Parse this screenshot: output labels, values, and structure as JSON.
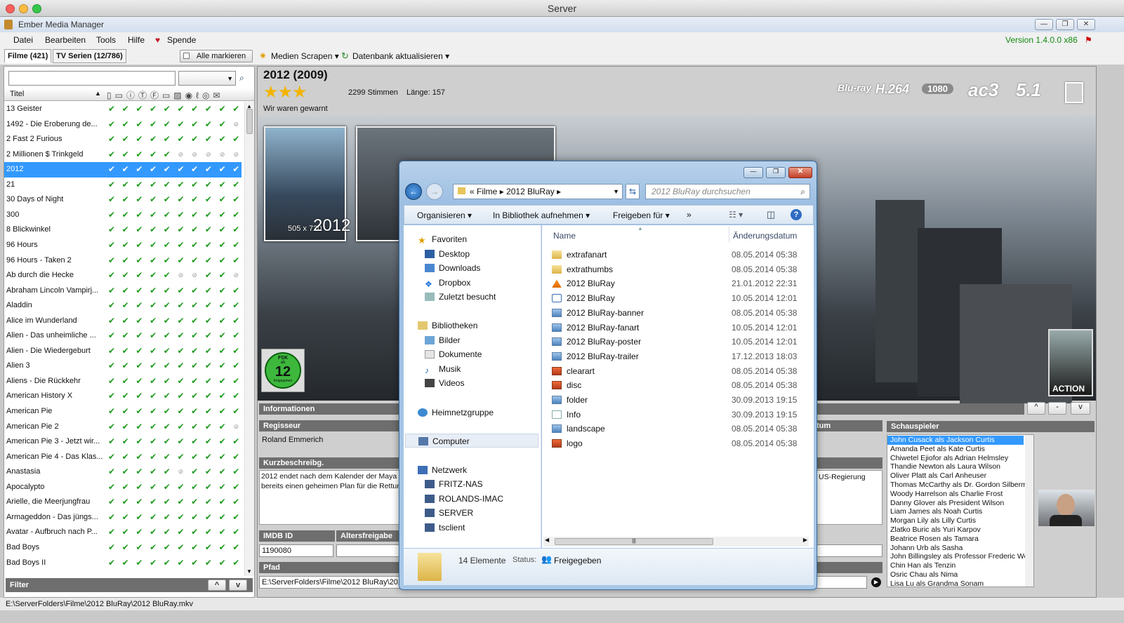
{
  "mac_title": "Server",
  "app_title": "Ember Media Manager",
  "menu": [
    "Datei",
    "Bearbeiten",
    "Tools",
    "Hilfe",
    "Spende"
  ],
  "version": "Version 1.4.0.0 x86",
  "tabs": {
    "movies": "Filme (421)",
    "tv": "TV Serien (12/786)"
  },
  "toolbar": {
    "mark_all": "Alle markieren",
    "scrape": "Medien Scrapen",
    "update_db": "Datenbank aktualisieren"
  },
  "list": {
    "column_title": "Titel",
    "filter_label": "Filter",
    "movies": [
      {
        "title": "13 Geister",
        "flags": "1111111111"
      },
      {
        "title": "1492 - Die Eroberung de...",
        "flags": "1111111110"
      },
      {
        "title": "2 Fast 2 Furious",
        "flags": "1111111111"
      },
      {
        "title": "2 Millionen $ Trinkgeld",
        "flags": "1111100000"
      },
      {
        "title": "2012",
        "flags": "1111111111",
        "selected": true
      },
      {
        "title": "21",
        "flags": "1111111111"
      },
      {
        "title": "30 Days of Night",
        "flags": "1111111111"
      },
      {
        "title": "300",
        "flags": "1111111111"
      },
      {
        "title": "8 Blickwinkel",
        "flags": "1111111111"
      },
      {
        "title": "96 Hours",
        "flags": "1111111111"
      },
      {
        "title": "96 Hours - Taken 2",
        "flags": "1111111111"
      },
      {
        "title": "Ab durch die Hecke",
        "flags": "1111100110"
      },
      {
        "title": "Abraham Lincoln Vampirj...",
        "flags": "1111111111"
      },
      {
        "title": "Aladdin",
        "flags": "1111111111"
      },
      {
        "title": "Alice im Wunderland",
        "flags": "1111111111"
      },
      {
        "title": "Alien - Das unheimliche ...",
        "flags": "1111111111"
      },
      {
        "title": "Alien - Die Wiedergeburt",
        "flags": "1111111111"
      },
      {
        "title": "Alien 3",
        "flags": "1111111111"
      },
      {
        "title": "Aliens - Die Rückkehr",
        "flags": "1111111111"
      },
      {
        "title": "American History X",
        "flags": "1111111111"
      },
      {
        "title": "American Pie",
        "flags": "1111111111"
      },
      {
        "title": "American Pie 2",
        "flags": "1111111110"
      },
      {
        "title": "American Pie 3 - Jetzt wir...",
        "flags": "1111111111"
      },
      {
        "title": "American Pie 4 - Das Klas...",
        "flags": "1111111111"
      },
      {
        "title": "Anastasia",
        "flags": "1111101111"
      },
      {
        "title": "Apocalypto",
        "flags": "1111111111"
      },
      {
        "title": "Arielle, die Meerjungfrau",
        "flags": "1111111111"
      },
      {
        "title": "Armageddon - Das jüngs...",
        "flags": "1111111111"
      },
      {
        "title": "Avatar - Aufbruch nach P...",
        "flags": "1111111111"
      },
      {
        "title": "Bad Boys",
        "flags": "1111111111"
      },
      {
        "title": "Bad Boys II",
        "flags": "1111111111"
      }
    ]
  },
  "movie": {
    "title": "2012 (2009)",
    "votes": "2299 Stimmen",
    "length": "Länge: 157",
    "tagline": "Wir waren gewarnt",
    "poster_size": "505 x 720",
    "poster_label": "2012",
    "fsk": {
      "top": "FSK",
      "sub": "ab",
      "age": "12",
      "bottom": "freigegeben"
    },
    "genre": "ACTION",
    "flags": [
      "Blu-ray",
      "H.264",
      "1080",
      "ac3",
      "5.1"
    ],
    "sections": {
      "info": "Informationen",
      "director": "Regisseur",
      "plot": "Kurzbeschreibg.",
      "imdb": "IMDB ID",
      "cert": "Altersfreigabe",
      "path": "Pfad",
      "actors": "Schauspieler",
      "date_partial": "tum"
    },
    "director": "Roland Emmerich",
    "plot_left": "2012 endet nach dem Kalender der Maya e",
    "plot_left2": "bereits einen geheimen Plan für die Rettung",
    "plot_right": "US-Regierung",
    "imdb_id": "1190080",
    "path": "E:\\ServerFolders\\Filme\\2012 BluRay\\2012",
    "actors": [
      "John Cusack als Jackson Curtis",
      "Amanda Peet als Kate Curtis",
      "Chiwetel Ejiofor als Adrian Helmsley",
      "Thandie Newton als Laura Wilson",
      "Oliver Platt als Carl Anheuser",
      "Thomas McCarthy als Dr. Gordon Silberman",
      "Woody Harrelson als Charlie Frost",
      "Danny Glover als President Wilson",
      "Liam James als Noah Curtis",
      "Morgan Lily als Lilly Curtis",
      "Zlatko Buric als Yuri Karpov",
      "Beatrice Rosen als Tamara",
      "Johann Urb als Sasha",
      "John Billingsley als Professor Frederic West",
      "Chin Han als Tenzin",
      "Osric Chau als Nima",
      "Lisa Lu als Grandma Sonam"
    ]
  },
  "explorer": {
    "breadcrumb": [
      "Filme",
      "2012 BluRay"
    ],
    "search_placeholder": "2012 BluRay durchsuchen",
    "commands": [
      "Organisieren",
      "In Bibliothek aufnehmen",
      "Freigeben für"
    ],
    "col_name": "Name",
    "col_date": "Änderungsdatum",
    "nav": {
      "favorites": "Favoriten",
      "desktop": "Desktop",
      "downloads": "Downloads",
      "dropbox": "Dropbox",
      "recent": "Zuletzt besucht",
      "libraries": "Bibliotheken",
      "pictures": "Bilder",
      "documents": "Dokumente",
      "music": "Musik",
      "videos": "Videos",
      "homegroup": "Heimnetzgruppe",
      "computer": "Computer",
      "network": "Netzwerk",
      "net1": "FRITZ-NAS",
      "net2": "ROLANDS-IMAC",
      "net3": "SERVER",
      "net4": "tsclient"
    },
    "files": [
      {
        "name": "extrafanart",
        "date": "08.05.2014 05:38",
        "kind": "folder"
      },
      {
        "name": "extrathumbs",
        "date": "08.05.2014 05:38",
        "kind": "folder"
      },
      {
        "name": "2012 BluRay",
        "date": "21.01.2012 22:31",
        "kind": "vlc"
      },
      {
        "name": "2012 BluRay",
        "date": "10.05.2014 12:01",
        "kind": "nfo"
      },
      {
        "name": "2012 BluRay-banner",
        "date": "08.05.2014 05:38",
        "kind": "image"
      },
      {
        "name": "2012 BluRay-fanart",
        "date": "10.05.2014 12:01",
        "kind": "image"
      },
      {
        "name": "2012 BluRay-poster",
        "date": "10.05.2014 12:01",
        "kind": "image"
      },
      {
        "name": "2012 BluRay-trailer",
        "date": "17.12.2013 18:03",
        "kind": "image"
      },
      {
        "name": "clearart",
        "date": "08.05.2014 05:38",
        "kind": "png"
      },
      {
        "name": "disc",
        "date": "08.05.2014 05:38",
        "kind": "png"
      },
      {
        "name": "folder",
        "date": "30.09.2013 19:15",
        "kind": "image"
      },
      {
        "name": "Info",
        "date": "30.09.2013 19:15",
        "kind": "doc"
      },
      {
        "name": "landscape",
        "date": "08.05.2014 05:38",
        "kind": "image"
      },
      {
        "name": "logo",
        "date": "08.05.2014 05:38",
        "kind": "png"
      }
    ],
    "count": "14 Elemente",
    "status_label": "Status:",
    "status_value": "Freigegeben"
  },
  "statusbar": "E:\\ServerFolders\\Filme\\2012 BluRay\\2012 BluRay.mkv"
}
